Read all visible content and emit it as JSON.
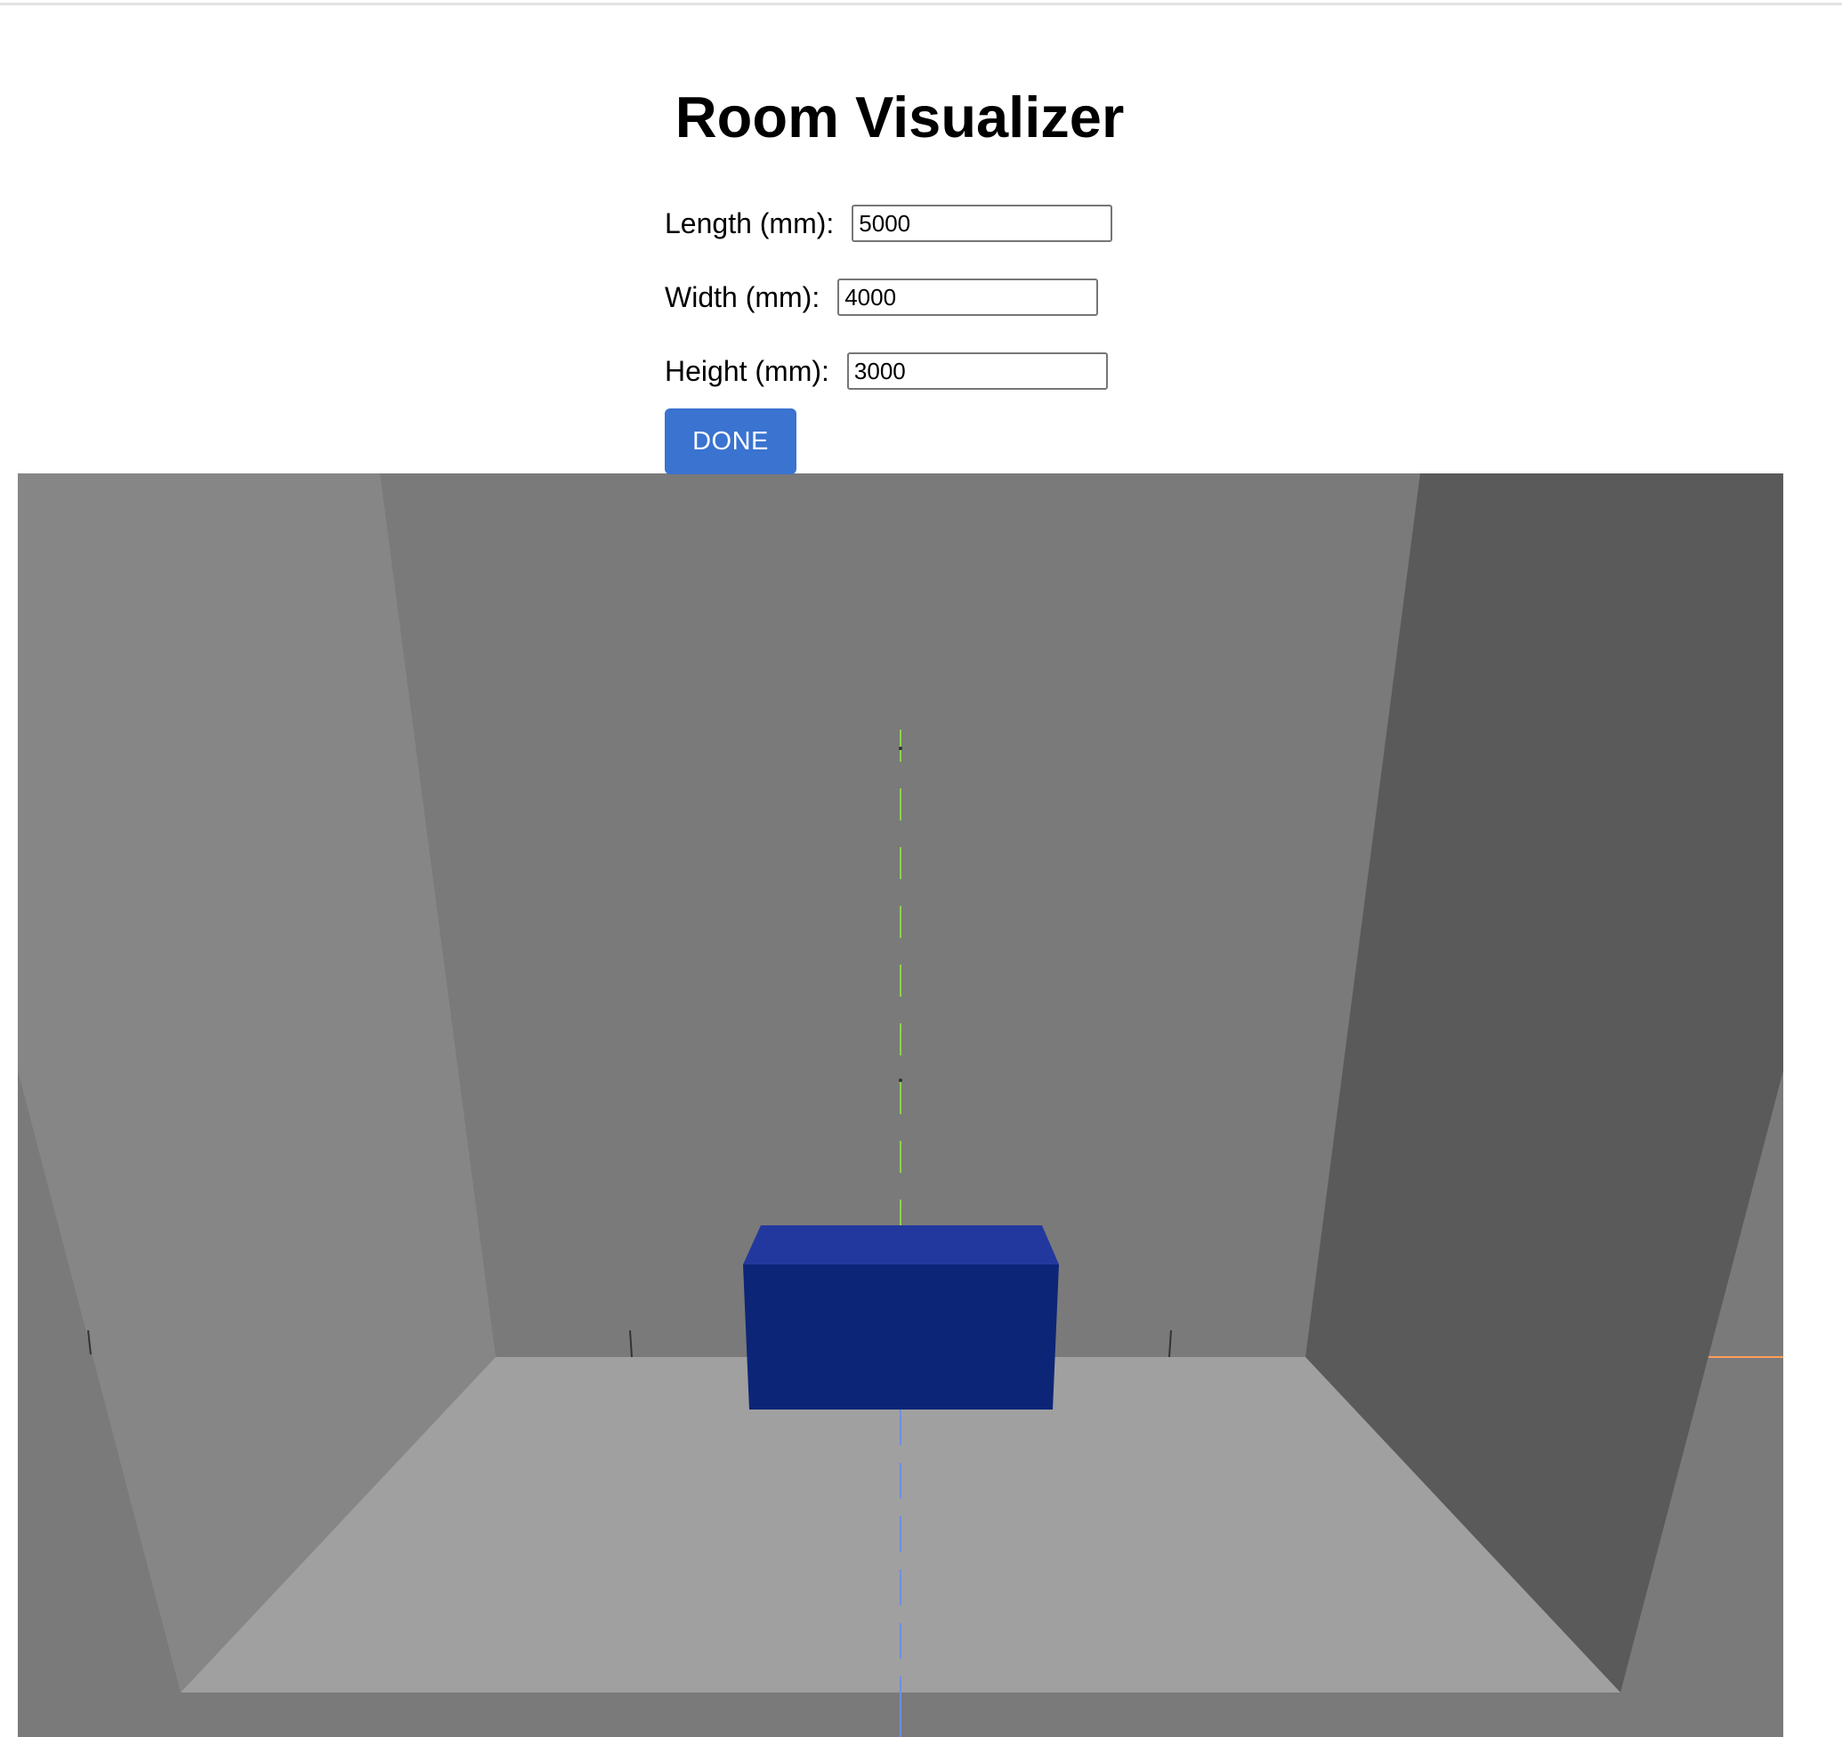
{
  "page": {
    "title": "Room Visualizer"
  },
  "form": {
    "length": {
      "label": "Length (mm):",
      "value": "5000"
    },
    "width": {
      "label": "Width (mm):",
      "value": "4000"
    },
    "height": {
      "label": "Height (mm):",
      "value": "3000"
    },
    "done_label": "DONE"
  },
  "scene": {
    "colors": {
      "back_wall": "#7a7a7a",
      "left_wall": "#868686",
      "right_wall": "#5a5a5a",
      "floor": "#a0a0a0",
      "box_front": "#0c2577",
      "box_top": "#23389e",
      "axis_y": "#8fd14f",
      "axis_x": "#ff9e5a",
      "axis_z": "#6f8fe0",
      "accent": "#3a73d0"
    }
  }
}
